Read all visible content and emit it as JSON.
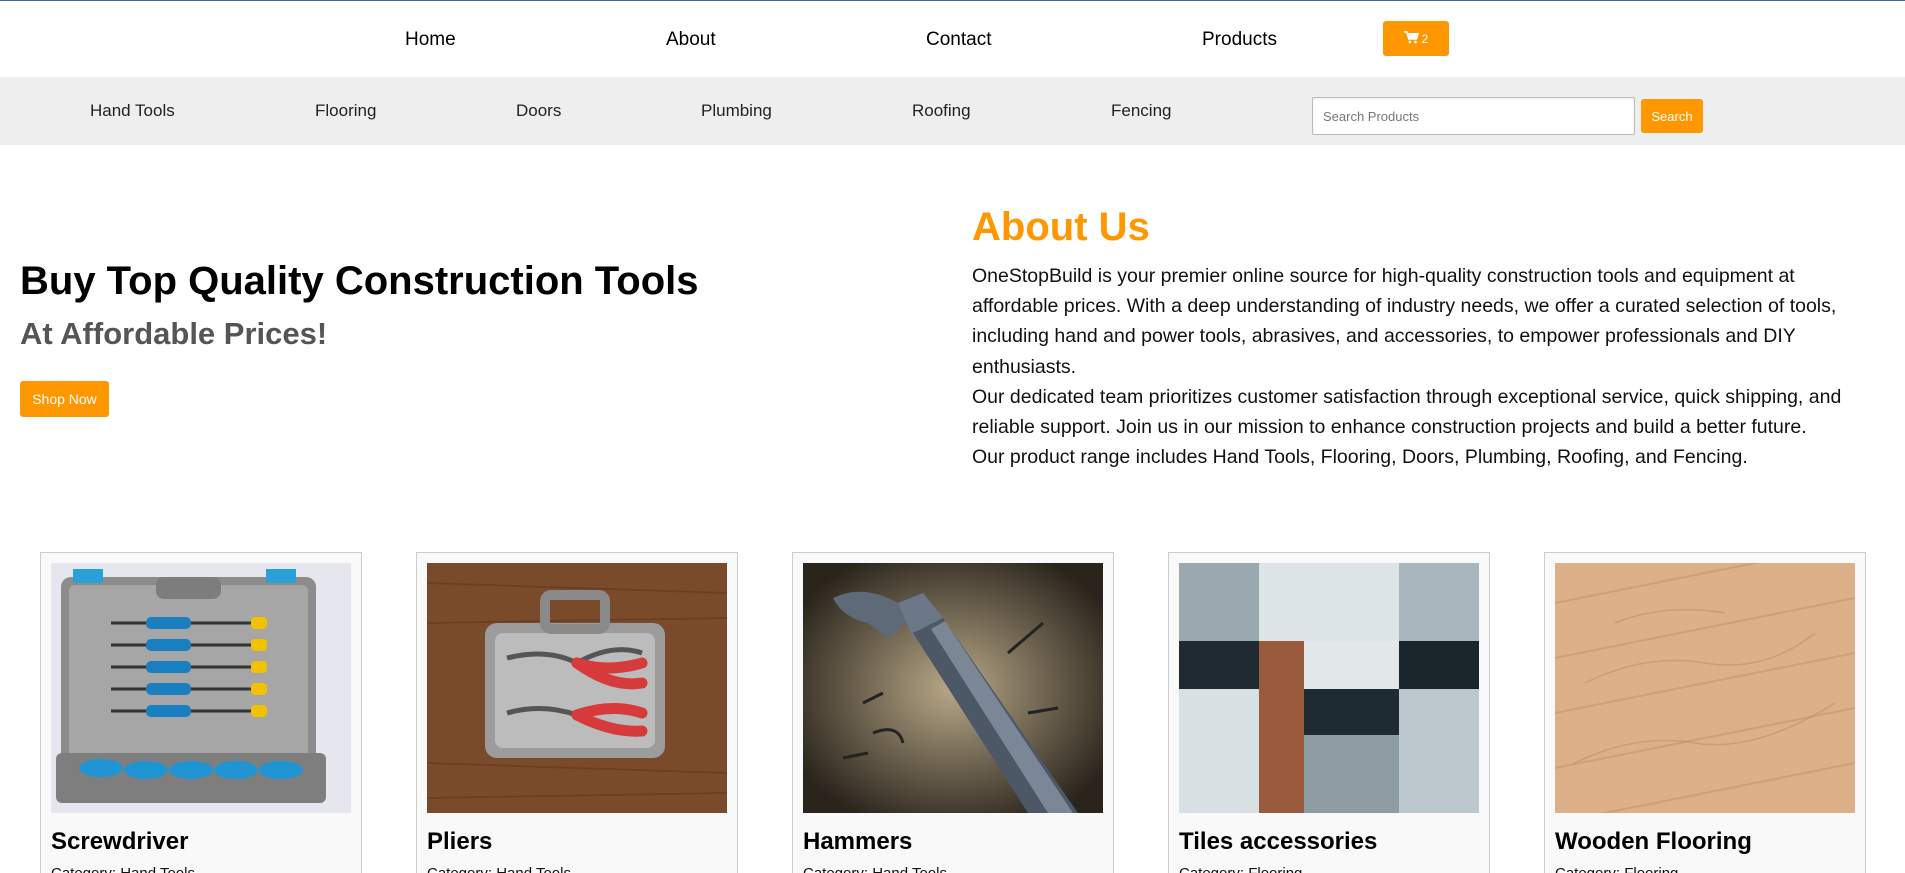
{
  "topnav": {
    "links": [
      "Home",
      "About",
      "Contact",
      "Products"
    ],
    "cart_count": "2",
    "cart_icon": "shopping-cart-icon"
  },
  "categories": [
    "Hand Tools",
    "Flooring",
    "Doors",
    "Plumbing",
    "Roofing",
    "Fencing"
  ],
  "search": {
    "placeholder": "Search Products",
    "button_label": "Search"
  },
  "hero": {
    "title": "Buy Top Quality Construction Tools",
    "subtitle": "At Affordable Prices!",
    "button_label": "Shop Now"
  },
  "about": {
    "title": "About Us",
    "paragraphs": [
      "OneStopBuild is your premier online source for high-quality construction tools and equipment at affordable prices. With a deep understanding of industry needs, we offer a curated selection of tools, including hand and power tools, abrasives, and accessories, to empower professionals and DIY enthusiasts.",
      "Our dedicated team prioritizes customer satisfaction through exceptional service, quick shipping, and reliable support. Join us in our mission to enhance construction projects and build a better future.",
      "Our product range includes Hand Tools, Flooring, Doors, Plumbing, Roofing, and Fencing."
    ]
  },
  "products": [
    {
      "name": "Screwdriver",
      "category": "Category: Hand Tools",
      "image": "screwdriver-set-image"
    },
    {
      "name": "Pliers",
      "category": "Category: Hand Tools",
      "image": "pliers-case-image"
    },
    {
      "name": "Hammers",
      "category": "Category: Hand Tools",
      "image": "hammer-image"
    },
    {
      "name": "Tiles accessories",
      "category": "Category: Flooring",
      "image": "marble-tiles-image"
    },
    {
      "name": "Wooden Flooring",
      "category": "Category: Flooring",
      "image": "wood-floor-image"
    }
  ],
  "colors": {
    "accent": "#ff9800",
    "category_bar": "#eeeeee",
    "subtitle": "#555555"
  }
}
